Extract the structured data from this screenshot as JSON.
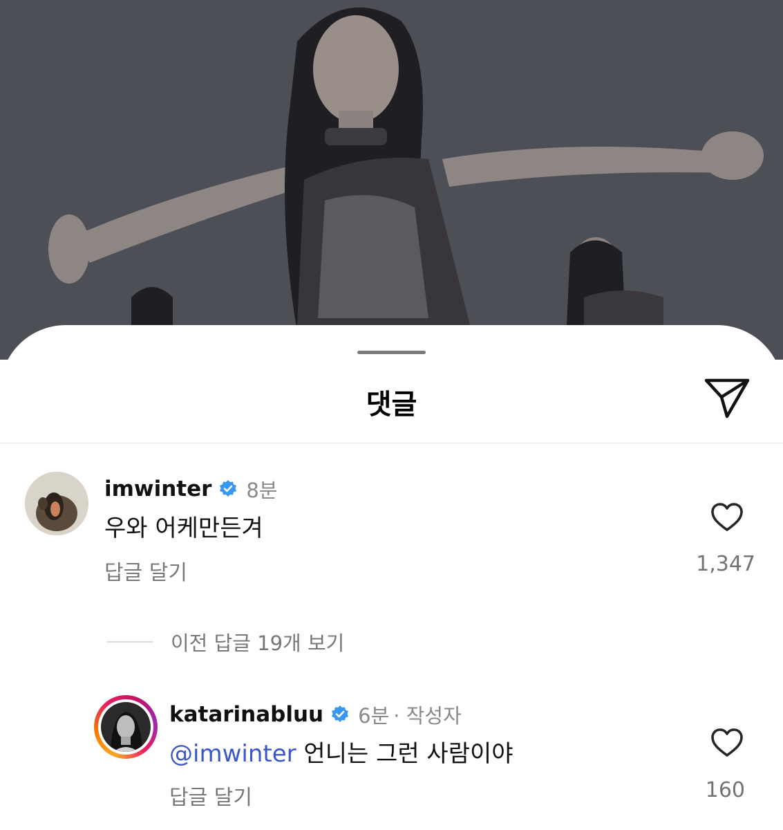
{
  "sheet": {
    "title": "댓글",
    "icons": {
      "send": "send-icon"
    }
  },
  "comments": [
    {
      "username": "imwinter",
      "verified": true,
      "time": "8분",
      "text": "우와 어케만든겨",
      "reply_label": "답글 달기",
      "likes": "1,347"
    }
  ],
  "view_replies": {
    "label": "이전 답글 19개 보기"
  },
  "replies": [
    {
      "username": "katarinabluu",
      "verified": true,
      "time": "6분",
      "author_tag": "· 작성자",
      "mention": "@imwinter",
      "text": " 언니는 그런 사람이야",
      "reply_label": "답글 달기",
      "likes": "160"
    }
  ],
  "colors": {
    "verified_blue": "#3897f0",
    "mention_blue": "#3b56c8",
    "story_ring": [
      "#f9a825",
      "#e91e63",
      "#c51162"
    ]
  }
}
